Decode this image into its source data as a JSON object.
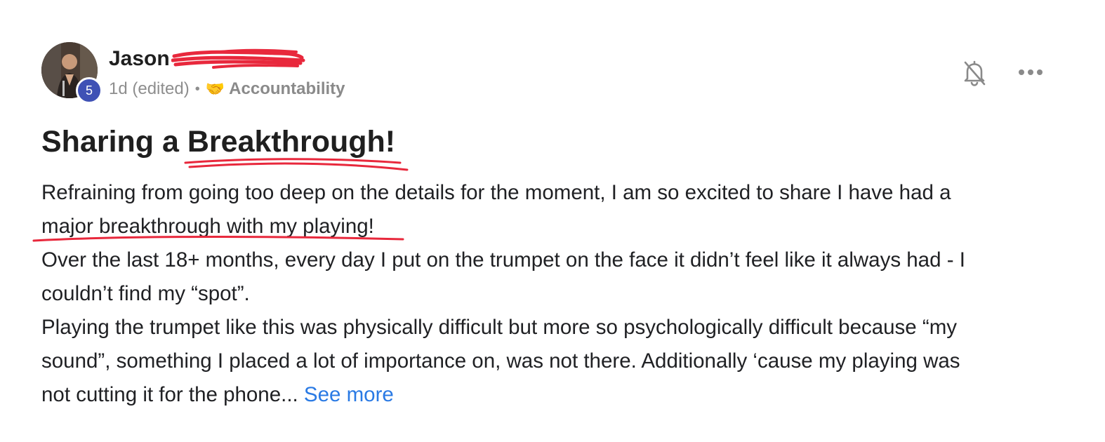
{
  "post": {
    "author": {
      "name": "Jason",
      "level": "5",
      "avatar_icon": "profile-photo"
    },
    "meta": {
      "time": "1d (edited)",
      "separator": "•",
      "category_icon": "🤝",
      "category": "Accountability"
    },
    "actions": {
      "notify_icon": "bell-off-icon",
      "more_icon": "more-horizontal-icon"
    },
    "title": "Sharing a Breakthrough!",
    "body": {
      "line1": "Refraining from going too deep on the details for the moment, I am so excited to share I have had a",
      "line2": "major breakthrough with my playing!",
      "para2_line1": "Over the last 18+ months, every day I put on the trumpet on the face it didn’t feel like it always had - I",
      "para2_line2": "couldn’t find my “spot”.",
      "para3_line1": "Playing the trumpet like this was physically difficult but more so psychologically difficult because “my",
      "para3_line2": "sound”, something I placed a lot of importance on, was not there. Additionally ‘cause my playing was",
      "para3_line3": "not cutting it for the phone...",
      "see_more": "See more"
    },
    "colors": {
      "accent_link": "#2a7ae4",
      "level_badge": "#3f51b5",
      "annotation_red": "#e8283c"
    }
  }
}
